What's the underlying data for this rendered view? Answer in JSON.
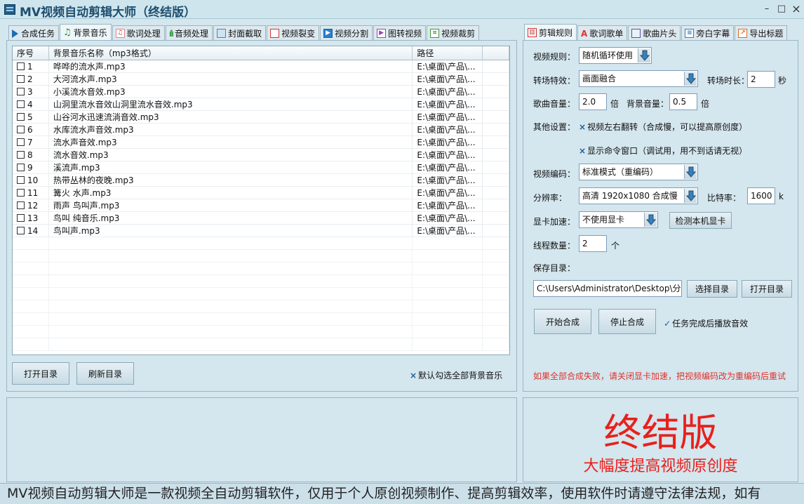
{
  "window": {
    "title": "MV视频自动剪辑大师（终结版）",
    "minimize": "–",
    "maximize": "□",
    "close": "×"
  },
  "left_tabs": [
    {
      "label": "合成任务",
      "icon": "play-icon"
    },
    {
      "label": "背景音乐",
      "icon": "music-note-icon"
    },
    {
      "label": "歌词处理",
      "icon": "lyrics-icon"
    },
    {
      "label": "音频处理",
      "icon": "waveform-icon"
    },
    {
      "label": "封面截取",
      "icon": "image-icon"
    },
    {
      "label": "视频裂变",
      "icon": "copy-icon"
    },
    {
      "label": "视频分割",
      "icon": "video-split-icon"
    },
    {
      "label": "图转视频",
      "icon": "image-to-video-icon"
    },
    {
      "label": "视频裁剪",
      "icon": "crop-icon"
    }
  ],
  "music_list": {
    "headers": [
      "序号",
      "背景音乐名称（mp3格式）",
      "路径",
      ""
    ],
    "rows": [
      {
        "no": "1",
        "name": "哗哗的流水声.mp3",
        "path": "E:\\桌面\\产品\\..."
      },
      {
        "no": "2",
        "name": "大河流水声.mp3",
        "path": "E:\\桌面\\产品\\..."
      },
      {
        "no": "3",
        "name": "小溪流水音效.mp3",
        "path": "E:\\桌面\\产品\\..."
      },
      {
        "no": "4",
        "name": "山洞里流水音效山洞里流水音效.mp3",
        "path": "E:\\桌面\\产品\\..."
      },
      {
        "no": "5",
        "name": "山谷河水迅速流淌音效.mp3",
        "path": "E:\\桌面\\产品\\..."
      },
      {
        "no": "6",
        "name": "水库流水声音效.mp3",
        "path": "E:\\桌面\\产品\\..."
      },
      {
        "no": "7",
        "name": "流水声音效.mp3",
        "path": "E:\\桌面\\产品\\..."
      },
      {
        "no": "8",
        "name": "流水音效.mp3",
        "path": "E:\\桌面\\产品\\..."
      },
      {
        "no": "9",
        "name": "溪流声.mp3",
        "path": "E:\\桌面\\产品\\..."
      },
      {
        "no": "10",
        "name": "热带丛林的夜晚.mp3",
        "path": "E:\\桌面\\产品\\..."
      },
      {
        "no": "11",
        "name": "篝火 水声.mp3",
        "path": "E:\\桌面\\产品\\..."
      },
      {
        "no": "12",
        "name": "雨声 鸟叫声.mp3",
        "path": "E:\\桌面\\产品\\..."
      },
      {
        "no": "13",
        "name": "鸟叫 纯音乐.mp3",
        "path": "E:\\桌面\\产品\\..."
      },
      {
        "no": "14",
        "name": "鸟叫声.mp3",
        "path": "E:\\桌面\\产品\\..."
      }
    ]
  },
  "left_buttons": {
    "open_dir": "打开目录",
    "refresh_dir": "刷新目录",
    "default_select_all": "默认勾选全部背景音乐"
  },
  "right_tabs": [
    {
      "label": "剪辑规则",
      "icon": "film-icon"
    },
    {
      "label": "歌词歌单",
      "icon": "text-icon"
    },
    {
      "label": "歌曲片头",
      "icon": "image-icon"
    },
    {
      "label": "旁白字幕",
      "icon": "document-icon"
    },
    {
      "label": "导出标题",
      "icon": "export-icon"
    }
  ],
  "rules": {
    "video_rule_label": "视频规则：",
    "video_rule_value": "随机循环使用",
    "transition_label": "转场特效：",
    "transition_value": "画面融合",
    "transition_duration_label": "转场时长：",
    "transition_duration_value": "2",
    "transition_duration_unit": "秒",
    "song_volume_label": "歌曲音量：",
    "song_volume_value": "2.0",
    "song_volume_unit": "倍",
    "bg_volume_label": "背景音量：",
    "bg_volume_value": "0.5",
    "bg_volume_unit": "倍",
    "other_label": "其他设置：",
    "flip_option": "视频左右翻转（合成慢，可以提高原创度）",
    "show_cmd_option": "显示命令窗口（调试用，用不到话请无视）",
    "encode_label": "视频编码：",
    "encode_value": "标准模式（重编码）",
    "resolution_label": "分辨率：",
    "resolution_value": "高清 1920x1080 合成慢",
    "bitrate_label": "比特率：",
    "bitrate_value": "1600",
    "bitrate_unit": "k",
    "gpu_label": "显卡加速：",
    "gpu_value": "不使用显卡",
    "detect_gpu_button": "检测本机显卡",
    "threads_label": "线程数量：",
    "threads_value": "2",
    "threads_unit": "个",
    "save_dir_label": "保存目录：",
    "save_dir_value": "C:\\Users\\Administrator\\Desktop\\分割",
    "choose_dir_button": "选择目录",
    "open_dir_button": "打开目录",
    "start_button": "开始合成",
    "stop_button": "停止合成",
    "play_sound_option": "任务完成后播放音效",
    "warning": "如果全部合成失败，请关闭显卡加速，把视频编码改为重编码后重试"
  },
  "promo": {
    "headline": "终结版",
    "subline": "大幅度提高视频原创度"
  },
  "marquee": "MV视频自动剪辑大师是一款视频全自动剪辑软件，仅用于个人原创视频制作、提高剪辑效率，使用软件时请遵守法律法规，如有",
  "colors": {
    "accent_red": "#e8201c",
    "warning_red": "#e0322c",
    "title_blue": "#1e4e6e"
  }
}
